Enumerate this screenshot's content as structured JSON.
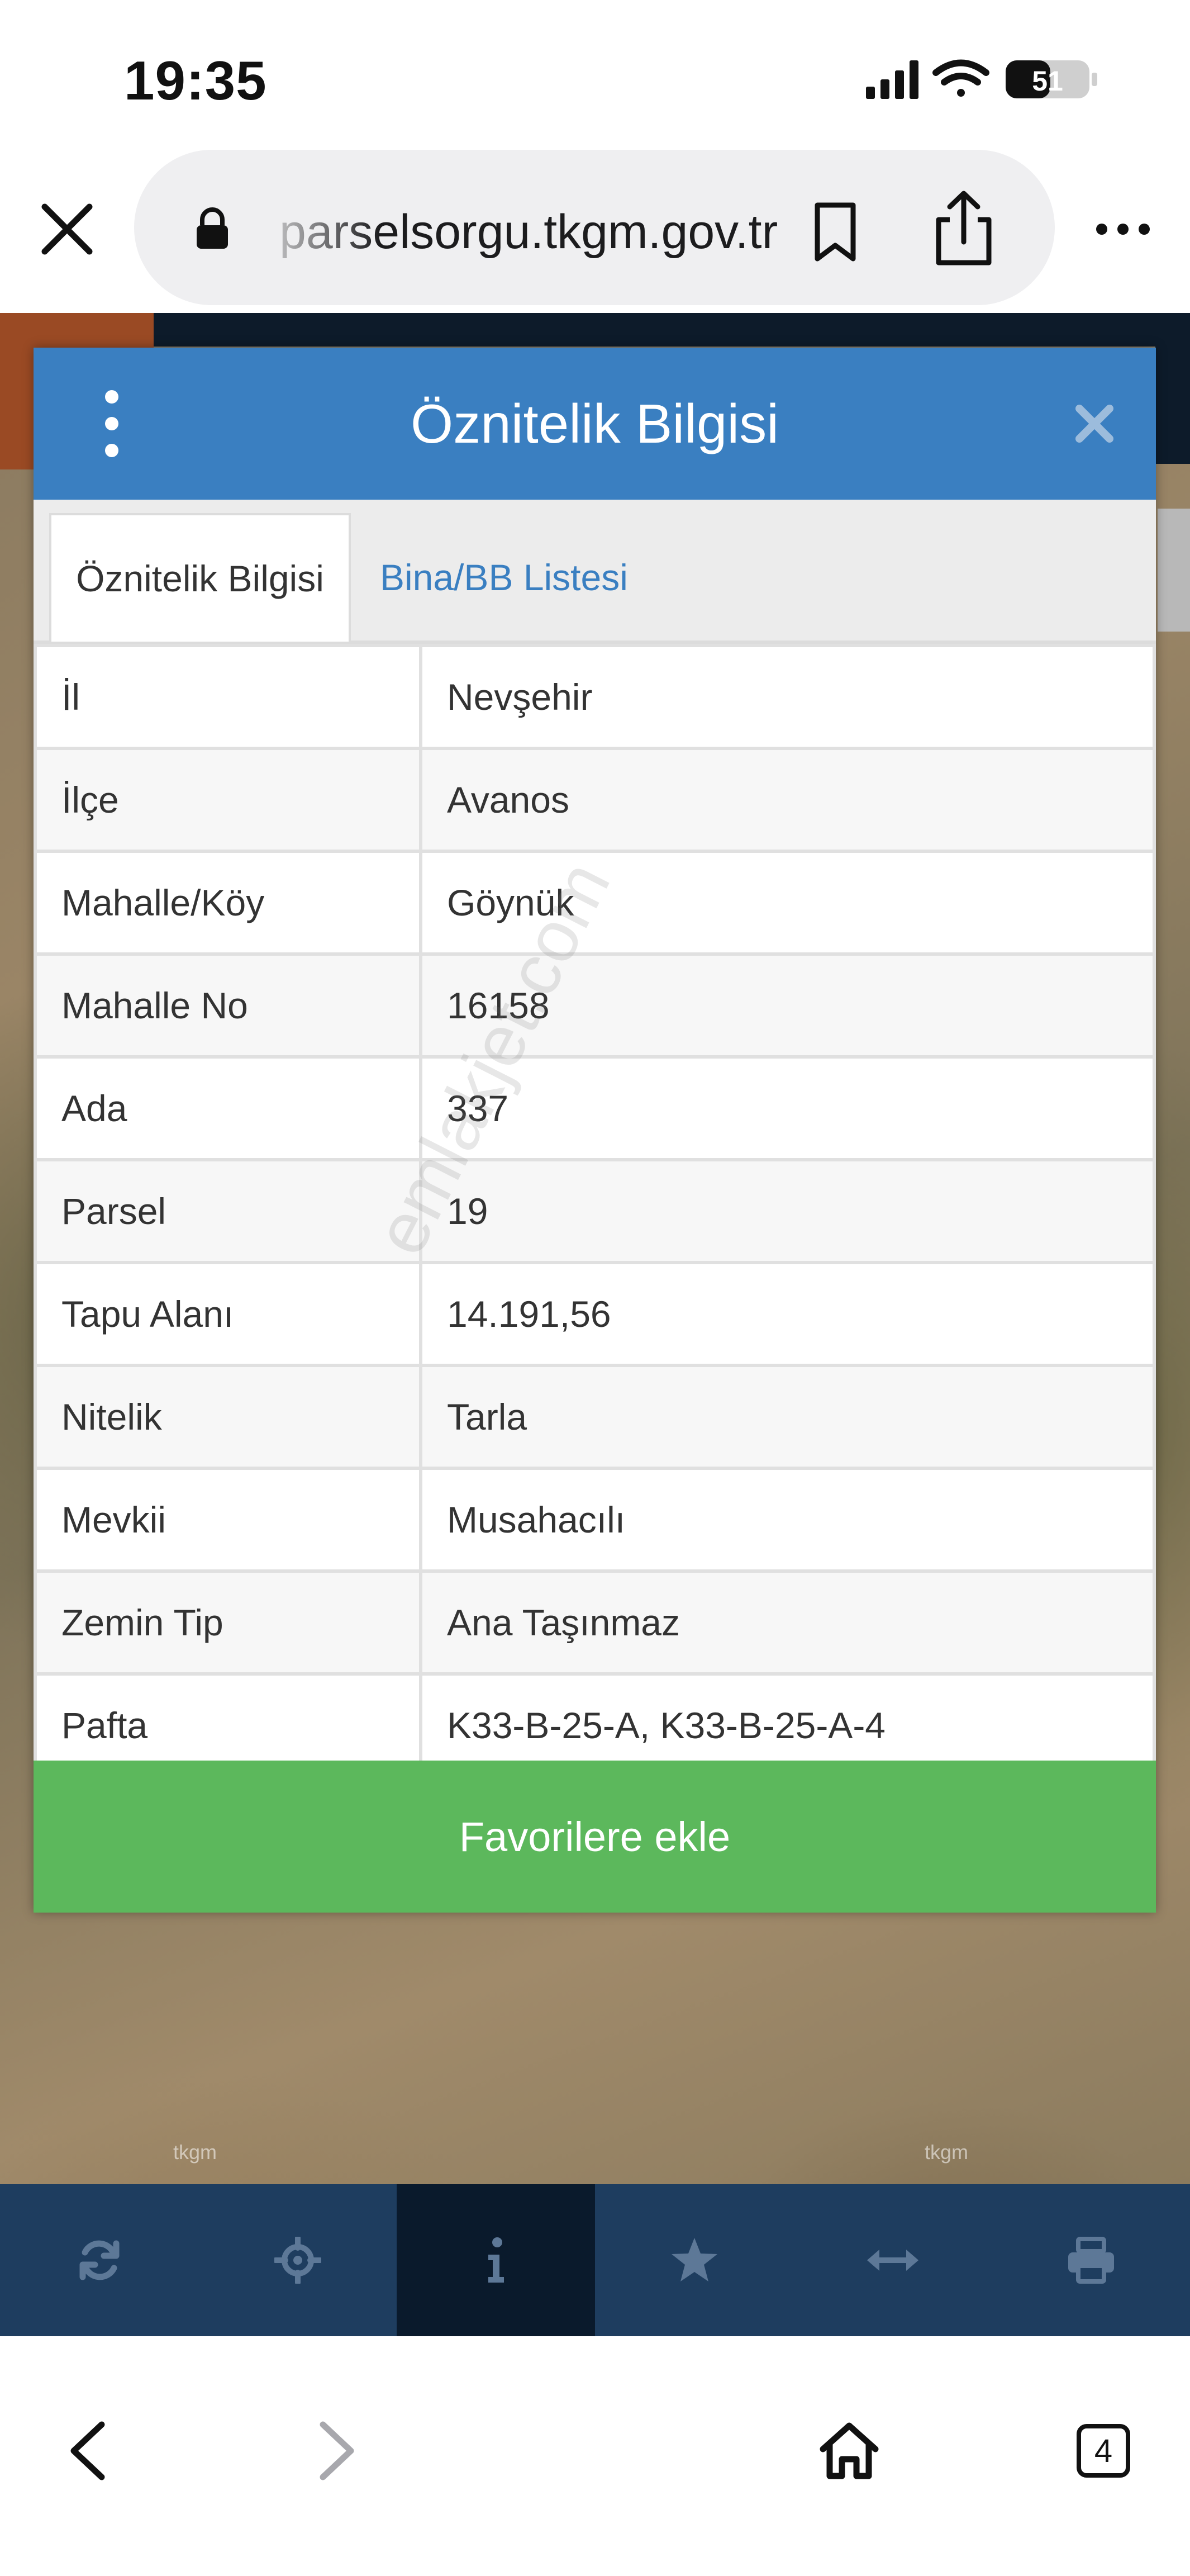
{
  "status_bar": {
    "time": "19:35",
    "battery": "51"
  },
  "browser": {
    "url": "parselsorgu.tkgm.gov.tr",
    "tab_count": "4"
  },
  "modal": {
    "title": "Öznitelik Bilgisi",
    "tabs": [
      {
        "label": "Öznitelik Bilgisi",
        "active": true
      },
      {
        "label": "Bina/BB Listesi",
        "active": false
      }
    ],
    "rows": [
      {
        "key": "İl",
        "value": "Nevşehir"
      },
      {
        "key": "İlçe",
        "value": "Avanos"
      },
      {
        "key": "Mahalle/Köy",
        "value": "Göynük"
      },
      {
        "key": "Mahalle No",
        "value": "16158"
      },
      {
        "key": "Ada",
        "value": "337"
      },
      {
        "key": "Parsel",
        "value": "19"
      },
      {
        "key": "Tapu Alanı",
        "value": "14.191,56"
      },
      {
        "key": "Nitelik",
        "value": "Tarla"
      },
      {
        "key": "Mevkii",
        "value": "Musahacılı"
      },
      {
        "key": "Zemin Tip",
        "value": "Ana Taşınmaz"
      },
      {
        "key": "Pafta",
        "value": "K33-B-25-A, K33-B-25-A-4"
      }
    ],
    "favorite_button": "Favorilere ekle"
  },
  "watermark": "emlakjet.com",
  "map": {
    "labels": [
      "tkgm",
      "tkgm"
    ]
  },
  "toolbar": {
    "buttons": [
      {
        "icon": "refresh-icon",
        "active": false
      },
      {
        "icon": "locate-icon",
        "active": false
      },
      {
        "icon": "info-icon",
        "active": true
      },
      {
        "icon": "star-icon",
        "active": false
      },
      {
        "icon": "measure-icon",
        "active": false
      },
      {
        "icon": "print-icon",
        "active": false
      }
    ]
  },
  "colors": {
    "header_blue": "#3a7fc1",
    "button_green": "#5cb85c",
    "toolbar_navy": "#1e3d5f",
    "toolbar_active": "#0a1a2c"
  }
}
